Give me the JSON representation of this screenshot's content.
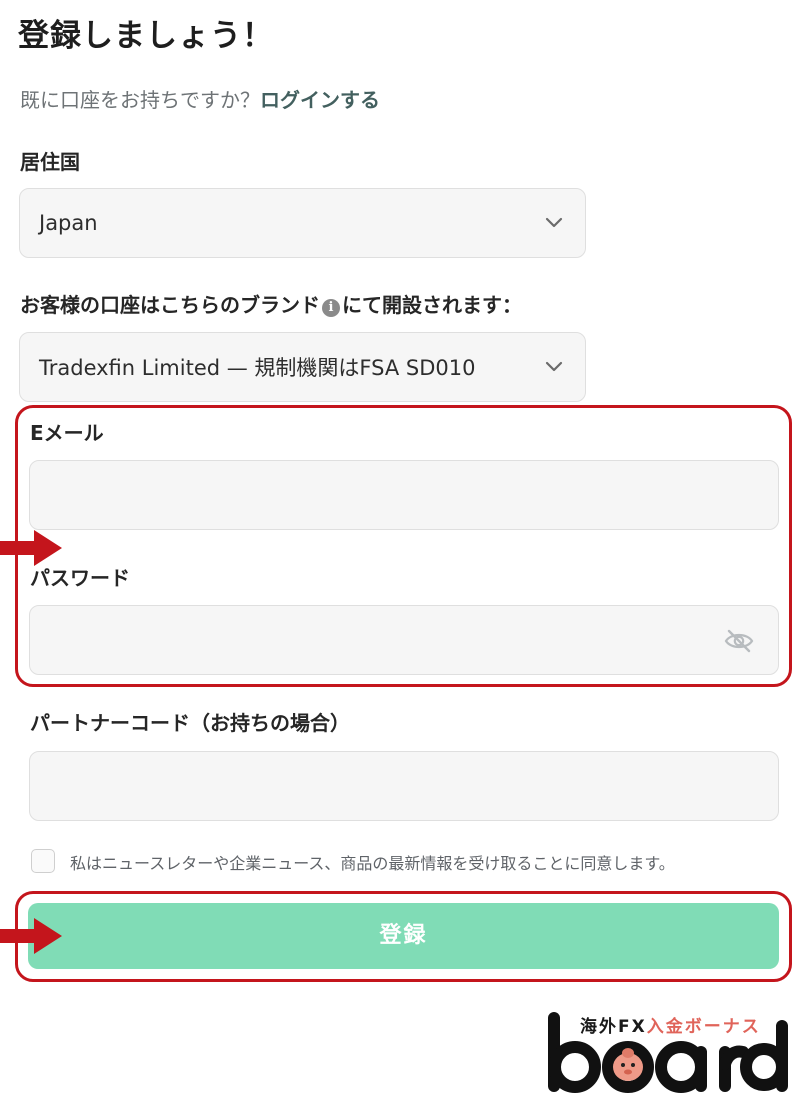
{
  "header": {
    "title": "登録しましょう！",
    "login_prompt": "既に口座をお持ちですか？",
    "login_link": "ログインする"
  },
  "form": {
    "country_label": "居住国",
    "country_value": "Japan",
    "brand_label_pre": "お客様の口座はこちらのブランド",
    "brand_label_post": "にて開設されます：",
    "brand_value": "Tradexfin Limited — 規制機関はFSA SD010",
    "email_label": "Eメール",
    "email_value": "",
    "password_label": "パスワード",
    "password_value": "",
    "partner_label": "パートナーコード（お持ちの場合）",
    "partner_value": "",
    "consent_text": "私はニュースレターや企業ニュース、商品の最新情報を受け取ることに同意します。",
    "consent_checked": false,
    "submit_label": "登録"
  },
  "watermark": {
    "tag_part1": "海外FX",
    "tag_part2": "入金ボーナス",
    "wordmark": "board"
  },
  "icons": {
    "chevron": "chevron-down-icon",
    "password_toggle": "eye-off-icon",
    "info": "info-icon",
    "annotation_arrow": "right-arrow-icon"
  },
  "colors": {
    "accent": "#80dcb6",
    "link": "#43605f",
    "annotation": "#c4151c",
    "logo_accent": "#e0645a"
  }
}
